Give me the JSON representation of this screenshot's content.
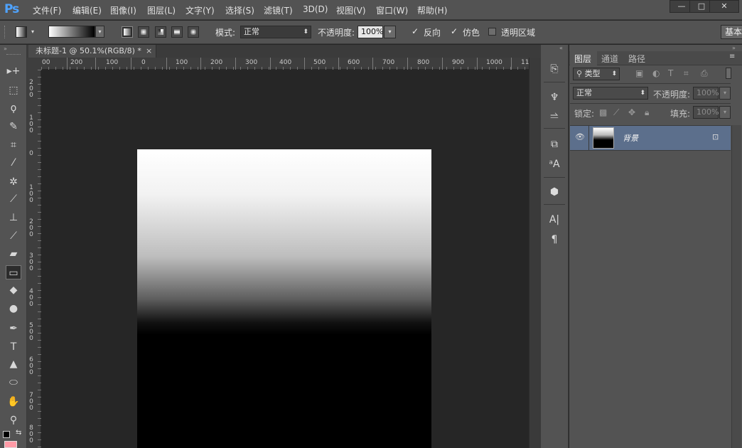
{
  "app": {
    "logo": "Ps"
  },
  "menu": {
    "items": [
      {
        "label": "文件(F)"
      },
      {
        "label": "编辑(E)"
      },
      {
        "label": "图像(I)"
      },
      {
        "label": "图层(L)"
      },
      {
        "label": "文字(Y)"
      },
      {
        "label": "选择(S)"
      },
      {
        "label": "滤镜(T)"
      },
      {
        "label": "3D(D)"
      },
      {
        "label": "视图(V)"
      },
      {
        "label": "窗口(W)"
      },
      {
        "label": "帮助(H)"
      }
    ]
  },
  "window_controls": {
    "minimize": "—",
    "restore": "□",
    "close": "✕"
  },
  "options": {
    "mode_label": "模式:",
    "mode_value": "正常",
    "opacity_label": "不透明度:",
    "opacity_value": "100%",
    "reverse_label": "反向",
    "dither_label": "仿色",
    "transparency_label": "透明区域",
    "workspace_button": "基本",
    "reverse_checked": true,
    "dither_checked": true,
    "transparency_checked": false
  },
  "document": {
    "tab_title": "未标题-1 @ 50.1%(RGB/8) *",
    "tab_close": "×",
    "ruler_h_labels": [
      "00",
      "200",
      "100",
      "0",
      "100",
      "200",
      "300",
      "400",
      "500",
      "600",
      "700",
      "800",
      "900",
      "1000",
      "11"
    ],
    "ruler_v_labels": [
      "200",
      "100",
      "0",
      "100",
      "200",
      "300",
      "400",
      "500",
      "600",
      "700",
      "800"
    ]
  },
  "tools": [
    {
      "icon": "move-icon",
      "glyph": "▸+"
    },
    {
      "icon": "marquee-icon",
      "glyph": "⬚"
    },
    {
      "icon": "lasso-icon",
      "glyph": "ϙ"
    },
    {
      "icon": "quick-select-icon",
      "glyph": "✎"
    },
    {
      "icon": "crop-icon",
      "glyph": "⌗"
    },
    {
      "icon": "eyedropper-icon",
      "glyph": "⁄"
    },
    {
      "icon": "healing-icon",
      "glyph": "✲"
    },
    {
      "icon": "brush-icon",
      "glyph": "⟋"
    },
    {
      "icon": "stamp-icon",
      "glyph": "⊥"
    },
    {
      "icon": "history-brush-icon",
      "glyph": "⟋"
    },
    {
      "icon": "eraser-icon",
      "glyph": "▰"
    },
    {
      "icon": "gradient-icon",
      "glyph": "▭"
    },
    {
      "icon": "blur-icon",
      "glyph": "◆"
    },
    {
      "icon": "dodge-icon",
      "glyph": "●"
    },
    {
      "icon": "pen-icon",
      "glyph": "✒"
    },
    {
      "icon": "type-icon",
      "glyph": "T"
    },
    {
      "icon": "path-select-icon",
      "glyph": "▲"
    },
    {
      "icon": "ellipse-icon",
      "glyph": "⬭"
    },
    {
      "icon": "hand-icon",
      "glyph": "✋"
    },
    {
      "icon": "zoom-icon",
      "glyph": "⚲"
    }
  ],
  "dock": [
    {
      "icon": "history-icon",
      "glyph": "⎘"
    },
    {
      "icon": "brush-panel-icon",
      "glyph": "♆"
    },
    {
      "icon": "brush-presets-icon",
      "glyph": "⥬"
    },
    {
      "icon": "clone-source-icon",
      "glyph": "⧉"
    },
    {
      "icon": "character-style-icon",
      "glyph": "ᵃA"
    },
    {
      "icon": "3d-icon",
      "glyph": "⬢"
    },
    {
      "icon": "character-icon",
      "glyph": "A|"
    },
    {
      "icon": "paragraph-icon",
      "glyph": "¶"
    }
  ],
  "layers_panel": {
    "tabs": [
      {
        "label": "图层"
      },
      {
        "label": "通道"
      },
      {
        "label": "路径"
      }
    ],
    "filter_label": "类型",
    "blend_mode": "正常",
    "opacity_label": "不透明度:",
    "opacity_value": "100%",
    "lock_label": "锁定:",
    "fill_label": "填充:",
    "fill_value": "100%",
    "layer_name": "背景"
  },
  "colors": {
    "accent_blue": "#4fa3ff",
    "selected_layer": "#5c6f8c",
    "foreground_swatch": "#ff9aa6"
  }
}
